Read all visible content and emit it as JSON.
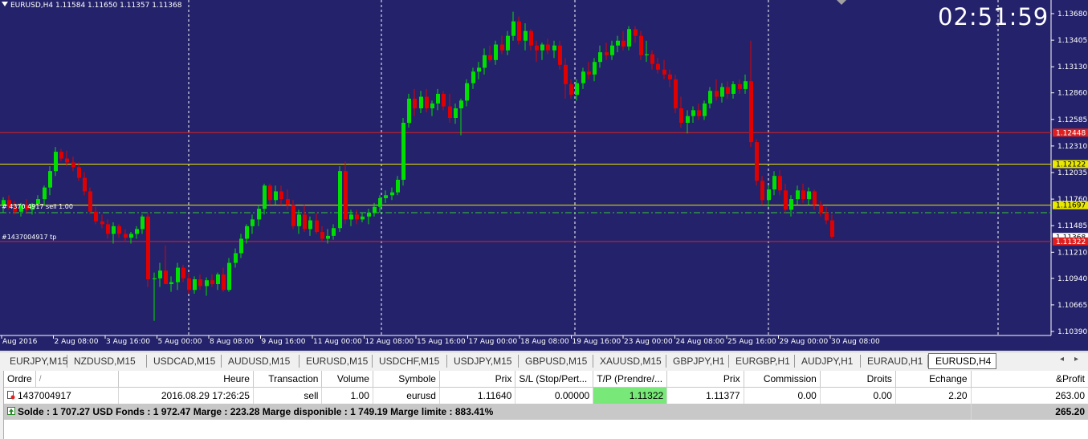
{
  "chart": {
    "title": "EURUSD,H4  1.11584 1.11650 1.11357 1.11368",
    "clock": "02:51:59",
    "order_label_upper": "# 4370 4917 sell 1.00",
    "order_label_tp": "#1437004917 tp",
    "price_ticks": [
      "1.13680",
      "1.13405",
      "1.13130",
      "1.12860",
      "1.12585",
      "1.12310",
      "1.12035",
      "1.11760",
      "1.11485",
      "1.11210",
      "1.10940",
      "1.10665",
      "1.10390"
    ],
    "price_labels": {
      "red_upper": "1.12448",
      "yellow_upper": "1.12122",
      "yellow_lower": "1.11697",
      "red_lower": "1.11322",
      "current": "1.11368"
    },
    "time_labels": [
      "Aug 2016",
      "2 Aug 08:00",
      "3 Aug 16:00",
      "5 Aug 00:00",
      "8 Aug 08:00",
      "9 Aug 16:00",
      "11 Aug 00:00",
      "12 Aug 08:00",
      "15 Aug 16:00",
      "17 Aug 00:00",
      "18 Aug 08:00",
      "19 Aug 16:00",
      "23 Aug 00:00",
      "24 Aug 08:00",
      "25 Aug 16:00",
      "29 Aug 00:00",
      "30 Aug 08:00"
    ],
    "colors": {
      "bg": "#24226b",
      "bull": "#00e000",
      "bear": "#e00000",
      "level_red": "#e02020",
      "level_yellow": "#e8e800",
      "dashed": "#ffffff"
    }
  },
  "tabs": [
    "EURJPY,M15",
    "NZDUSD,M15",
    "USDCAD,M15",
    "AUDUSD,M15",
    "EURUSD,M15",
    "USDCHF,M15",
    "USDJPY,M15",
    "GBPUSD,M15",
    "XAUUSD,M15",
    "GBPJPY,H1",
    "EURGBP,H1",
    "AUDJPY,H1",
    "EURAUD,H1",
    "EURUSD,H4"
  ],
  "active_tab": "EURUSD,H4",
  "tab_nav": {
    "prev": "◂",
    "next": "▸"
  },
  "terminal": {
    "headers": [
      "Ordre",
      "/",
      "Heure",
      "Transaction",
      "Volume",
      "Symbole",
      "Prix",
      "S/L (Stop/Pert...",
      "T/P (Prendre/...",
      "Prix",
      "Commission",
      "Droits",
      "Echange",
      "&Profit"
    ],
    "row": {
      "order": "1437004917",
      "time": "2016.08.29 17:26:25",
      "type": "sell",
      "volume": "1.00",
      "symbol": "eurusd",
      "open_price": "1.11640",
      "sl": "0.00000",
      "tp": "1.11322",
      "price": "1.11377",
      "commission": "0.00",
      "taxes": "0.00",
      "swap": "2.20",
      "profit": "263.00"
    },
    "summary": {
      "text": "Solde : 1 707.27 USD  Fonds : 1 972.47  Marge : 223.28  Marge disponible : 1 749.19  Marge limite : 883.41%",
      "total": "265.20"
    }
  }
}
